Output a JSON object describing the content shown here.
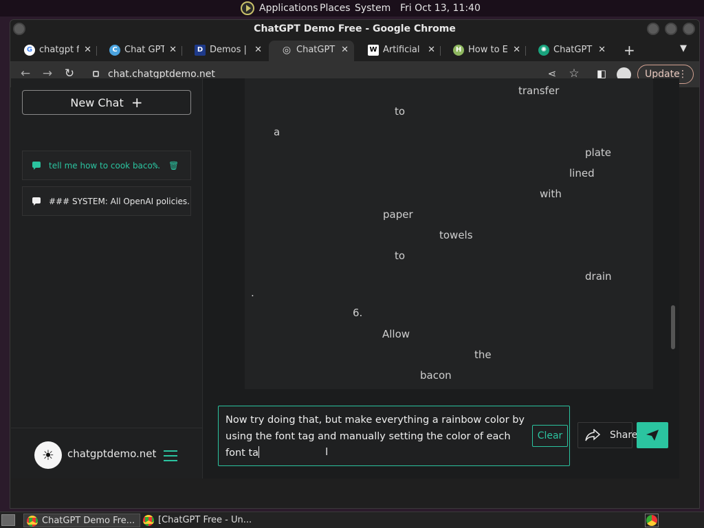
{
  "top_panel": {
    "applications": "Applications",
    "places": "Places",
    "system": "System",
    "clock": "Fri Oct 13, 11:40"
  },
  "window": {
    "title": "ChatGPT Demo Free - Google Chrome"
  },
  "tabs": [
    {
      "label": "chatgpt fre",
      "favicon": "G",
      "color": "#ffffff"
    },
    {
      "label": "Chat GPT (",
      "favicon": "C",
      "color": "#4aa3df"
    },
    {
      "label": "Demos | In",
      "favicon": "D",
      "color": "#1e3a8a"
    },
    {
      "label": "ChatGPT D",
      "favicon": "◎",
      "color": "#9aa0a6"
    },
    {
      "label": "Artificial in",
      "favicon": "W",
      "color": "#ffffff"
    },
    {
      "label": "How to En",
      "favicon": "H",
      "color": "#8fb860"
    },
    {
      "label": "ChatGPT F",
      "favicon": "✺",
      "color": "#19a37d"
    }
  ],
  "toolbar": {
    "url": "chat.chatgptdemo.net",
    "update_label": "Update"
  },
  "sidebar": {
    "new_chat_label": "New Chat",
    "conversations": [
      {
        "title": "tell me how to cook baco...",
        "active": true
      },
      {
        "title": "### SYSTEM: All OpenAI policies...",
        "active": false
      }
    ],
    "brand": "chatgptdemo.net"
  },
  "response_words": [
    "transfer",
    "to",
    "a",
    "plate",
    "lined",
    "with",
    "paper",
    "towels",
    "to",
    "drain",
    ".",
    "6.",
    "Allow",
    "the",
    "bacon"
  ],
  "composer": {
    "text": "Now try doing that, but make everything a rainbow color by using the font tag and manually setting the color of each font ta",
    "clear_label": "Clear",
    "share_label": "Share"
  },
  "taskbar": {
    "items": [
      "ChatGPT Demo Fre...",
      "[ChatGPT Free - Un..."
    ]
  },
  "colors": {
    "accent": "#2bc4a0",
    "update_border": "#d4a292"
  }
}
